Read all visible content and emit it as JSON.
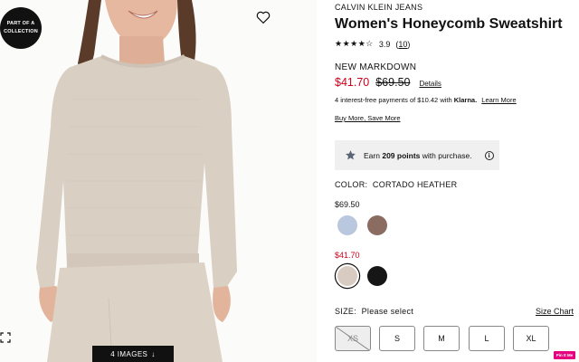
{
  "gallery": {
    "badge_line1": "PART OF A",
    "badge_line2": "COLLECTION",
    "images_button": "4 IMAGES",
    "images_arrow": "↓"
  },
  "product": {
    "brand": "CALVIN KLEIN JEANS",
    "title": "Women's Honeycomb Sweatshirt",
    "stars": "★★★★☆",
    "rating": "3.9",
    "review_count": "10",
    "markdown_label": "NEW MARKDOWN",
    "sale_price": "$41.70",
    "original_price": "$69.50",
    "details_link": "Details",
    "installments_text": "4 interest-free payments of $10.42 with",
    "klarna": "Klarna.",
    "learn_more": "Learn More",
    "buy_more": "Buy More, Save More",
    "points_prefix": "Earn",
    "points_value": "209 points",
    "points_suffix": "with purchase."
  },
  "color": {
    "label": "COLOR:",
    "selected_name": "CORTADO HEATHER",
    "group1_price": "$69.50",
    "group2_price": "$41.70",
    "swatches": [
      {
        "name": "light-blue",
        "color": "#b9c7df"
      },
      {
        "name": "brown",
        "color": "#8a6c60"
      },
      {
        "name": "cortado-heather",
        "color": "#d8ccc2"
      },
      {
        "name": "black",
        "color": "#161616"
      }
    ]
  },
  "size": {
    "label": "SIZE:",
    "selected": "Please select",
    "chart_link": "Size Chart",
    "options": [
      "XS",
      "S",
      "M",
      "L",
      "XL"
    ],
    "unavailable": [
      "XS"
    ]
  },
  "overlay": {
    "pin_badge": "Pin It Me"
  }
}
